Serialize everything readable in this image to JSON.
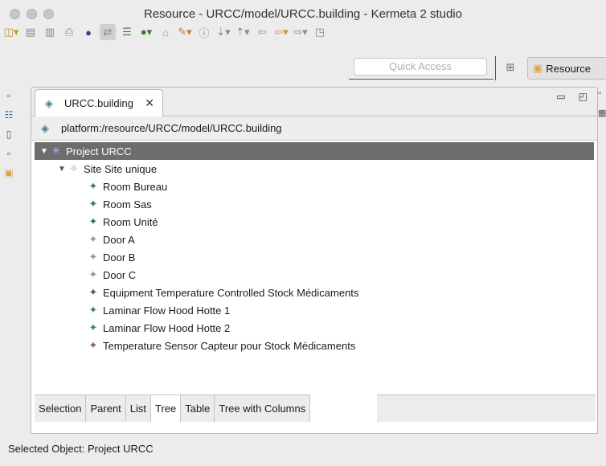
{
  "window": {
    "title": "Resource - URCC/model/URCC.building - Kermeta 2 studio"
  },
  "toolbar": {
    "icons": [
      "new-wizard-icon",
      "save-icon",
      "save-all-icon",
      "print-icon",
      "globe-icon",
      "link-icon",
      "list-icon",
      "run-icon",
      "open-folder-icon",
      "pencil-icon",
      "info-icon",
      "next-annotation-icon",
      "previous-annotation-icon",
      "back-icon",
      "forward-icon",
      "pin-icon"
    ]
  },
  "quick_access": {
    "placeholder": "Quick Access"
  },
  "perspective": {
    "label": "Resource"
  },
  "editor": {
    "tab_label": "URCC.building",
    "resource_path": "platform:/resource/URCC/model/URCC.building"
  },
  "tree": {
    "root": "Project URCC",
    "site": "Site Site unique",
    "items": [
      {
        "label": "Room Bureau",
        "color": "#3f6f7a"
      },
      {
        "label": "Room Sas",
        "color": "#3f6f7a"
      },
      {
        "label": "Room Unité",
        "color": "#3f6f7a"
      },
      {
        "label": "Door A",
        "color": "#8fa07a"
      },
      {
        "label": "Door B",
        "color": "#8fa07a"
      },
      {
        "label": "Door C",
        "color": "#8fa07a"
      },
      {
        "label": "Equipment Temperature Controlled Stock Médicaments",
        "color": "#3e6b45"
      },
      {
        "label": "Laminar Flow Hood Hotte 1",
        "color": "#4a7a8a"
      },
      {
        "label": "Laminar Flow Hood Hotte 2",
        "color": "#4a7a8a"
      },
      {
        "label": "Temperature Sensor Capteur pour Stock Médicaments",
        "color": "#8a5a7a"
      }
    ]
  },
  "bottom_tabs": [
    "Selection",
    "Parent",
    "List",
    "Tree",
    "Table",
    "Tree with Columns"
  ],
  "active_bottom_tab": "Tree",
  "status": {
    "text": "Selected Object: Project URCC"
  },
  "colors": {
    "selection_bg": "#6d6d6d",
    "folder": "#e2a23a"
  }
}
